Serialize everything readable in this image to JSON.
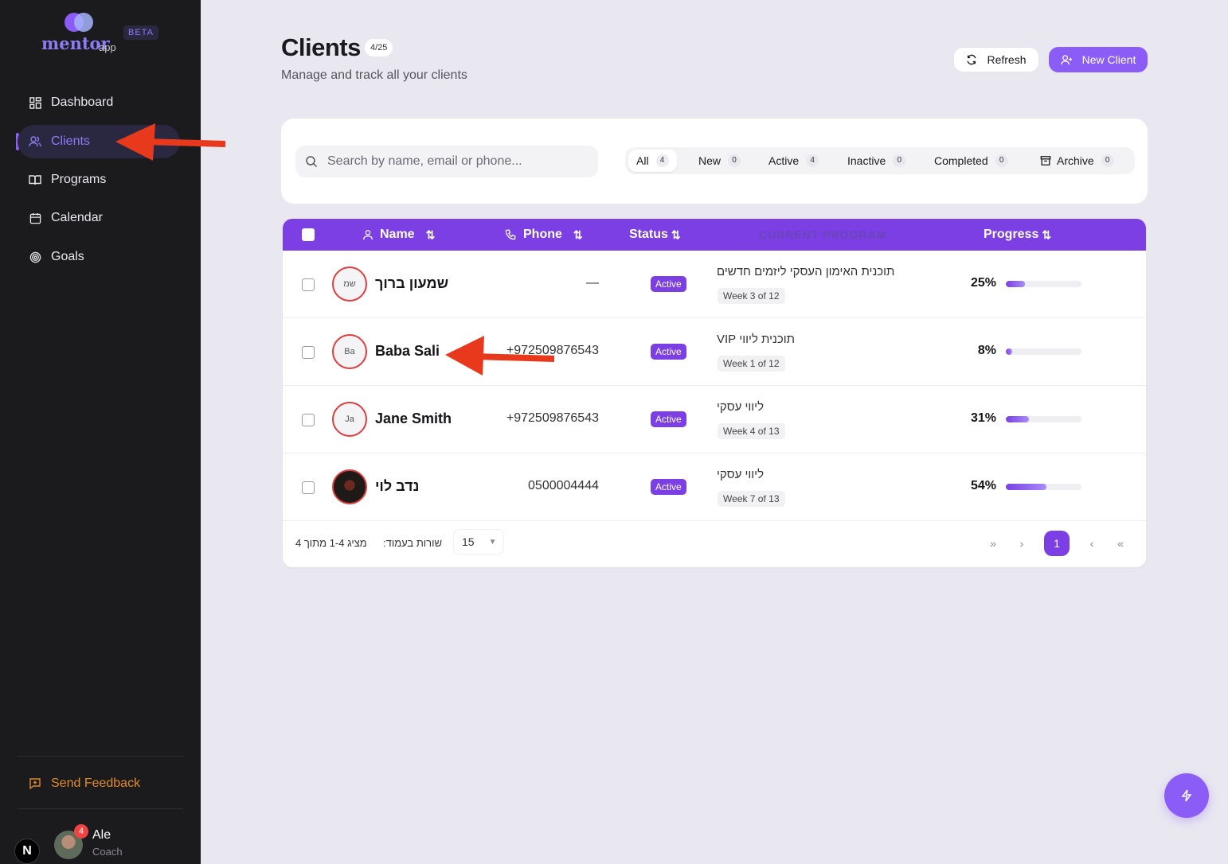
{
  "brand": {
    "wordmark": "mentor",
    "suffix": "app",
    "beta": "BETA"
  },
  "sidebar": {
    "items": [
      {
        "label": "Dashboard",
        "icon": "dashboard-icon"
      },
      {
        "label": "Clients",
        "icon": "users-icon",
        "active": true
      },
      {
        "label": "Programs",
        "icon": "book-icon"
      },
      {
        "label": "Calendar",
        "icon": "calendar-icon"
      },
      {
        "label": "Goals",
        "icon": "target-icon"
      }
    ],
    "feedback": "Send Feedback",
    "user": {
      "name": "Ale",
      "role": "Coach",
      "notifications": "4"
    },
    "next_badge": "N"
  },
  "header": {
    "title": "Clients",
    "count": "4/25",
    "subtitle": "Manage and track all your clients",
    "refresh": "Refresh",
    "new_client": "New Client"
  },
  "search": {
    "placeholder": "Search by name, email or phone..."
  },
  "filters": [
    {
      "label": "All",
      "count": "4",
      "selected": true
    },
    {
      "label": "New",
      "count": "0"
    },
    {
      "label": "Active",
      "count": "4"
    },
    {
      "label": "Inactive",
      "count": "0"
    },
    {
      "label": "Completed",
      "count": "0"
    },
    {
      "label": "Archive",
      "count": "0"
    }
  ],
  "table": {
    "columns": {
      "name": "Name",
      "phone": "Phone",
      "status": "Status",
      "program": "CURRENT PROGRAM",
      "progress": "Progress"
    },
    "rows": [
      {
        "initials": "שמ",
        "name": "שמעון ברוך",
        "phone": "—",
        "status": "Active",
        "program": "תוכנית האימון העסקי ליזמים חדשים",
        "week": "Week 3 of 12",
        "progress_label": "25%",
        "progress": 25
      },
      {
        "initials": "Ba",
        "name": "Baba Sali",
        "phone": "+972509876543",
        "status": "Active",
        "program": "תוכנית ליווי VIP",
        "week": "Week 1 of 12",
        "progress_label": "8%",
        "progress": 8
      },
      {
        "initials": "Ja",
        "name": "Jane Smith",
        "phone": "+972509876543",
        "status": "Active",
        "program": "ליווי עסקי",
        "week": "Week 4 of 13",
        "progress_label": "31%",
        "progress": 31
      },
      {
        "initials": "",
        "name": "נדב לוי",
        "phone": "0500004444",
        "status": "Active",
        "program": "ליווי עסקי",
        "week": "Week 7 of 13",
        "progress_label": "54%",
        "progress": 54
      }
    ],
    "footer": {
      "summary": "מציג 1-4 מתוך 4",
      "rows_label": "שורות בעמוד:",
      "rows_value": "15",
      "current_page": "1"
    }
  },
  "colors": {
    "accent": "#8b5cf6",
    "header": "#7b3fe4",
    "sidebar": "#1b1b1d",
    "feedback": "#e08a2a",
    "annotation": "#e8391c"
  }
}
